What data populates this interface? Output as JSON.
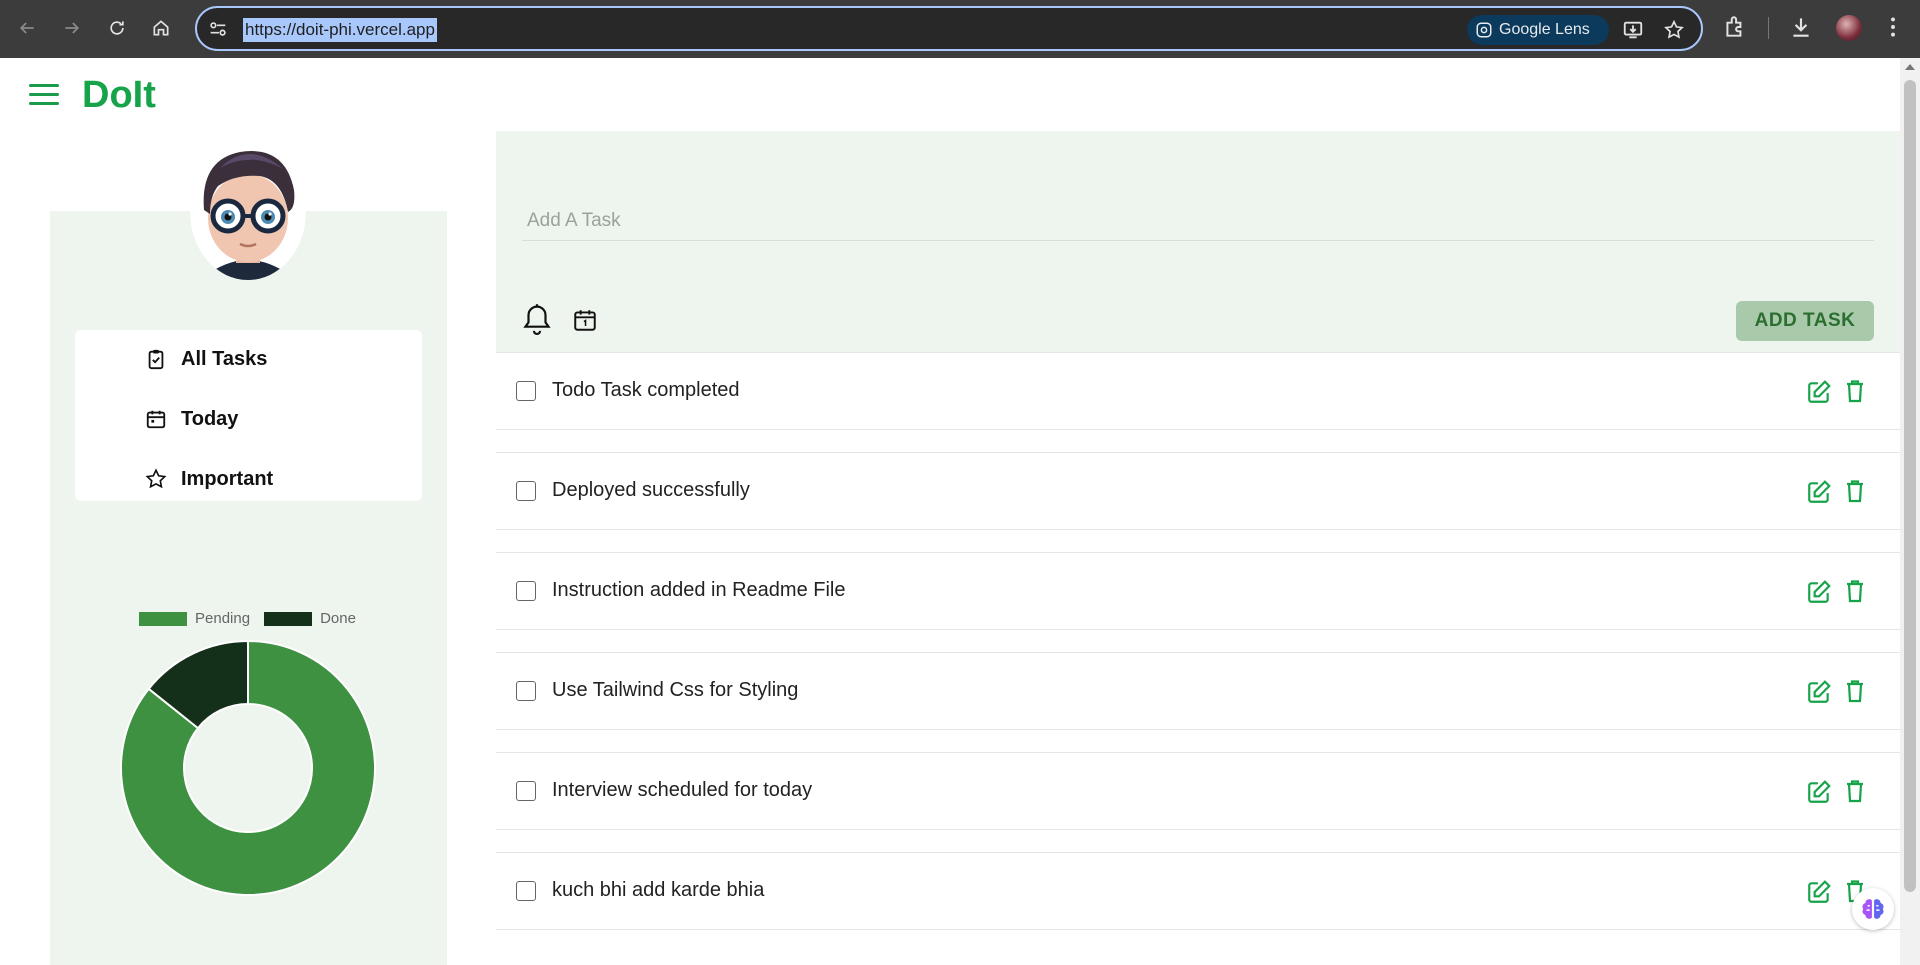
{
  "browser": {
    "url": "https://doit-phi.vercel.app",
    "lens_label": "Google Lens"
  },
  "app": {
    "brand": "DoIt",
    "colors": {
      "accent": "#16a34a",
      "panel_bg": "#eef4ee",
      "pending": "#3f9142",
      "done": "#15301a",
      "add_button_bg": "#a8c9aa"
    }
  },
  "sidebar": {
    "menu": [
      {
        "label": "All Tasks",
        "icon": "clipboard-check-icon"
      },
      {
        "label": "Today",
        "icon": "calendar-icon"
      },
      {
        "label": "Important",
        "icon": "star-icon"
      }
    ]
  },
  "chart_data": {
    "type": "pie",
    "variant": "doughnut",
    "categories": [
      "Pending",
      "Done"
    ],
    "values": [
      6,
      1
    ],
    "colors": [
      "#3f9142",
      "#15301a"
    ],
    "legend": "top"
  },
  "task_entry": {
    "placeholder": "Add A Task",
    "add_button": "ADD TASK"
  },
  "tasks": [
    {
      "text": "Todo Task completed"
    },
    {
      "text": "Deployed successfully"
    },
    {
      "text": "Instruction added in Readme File"
    },
    {
      "text": "Use Tailwind Css for Styling"
    },
    {
      "text": "Interview scheduled for today"
    },
    {
      "text": "kuch bhi add karde bhia"
    }
  ]
}
